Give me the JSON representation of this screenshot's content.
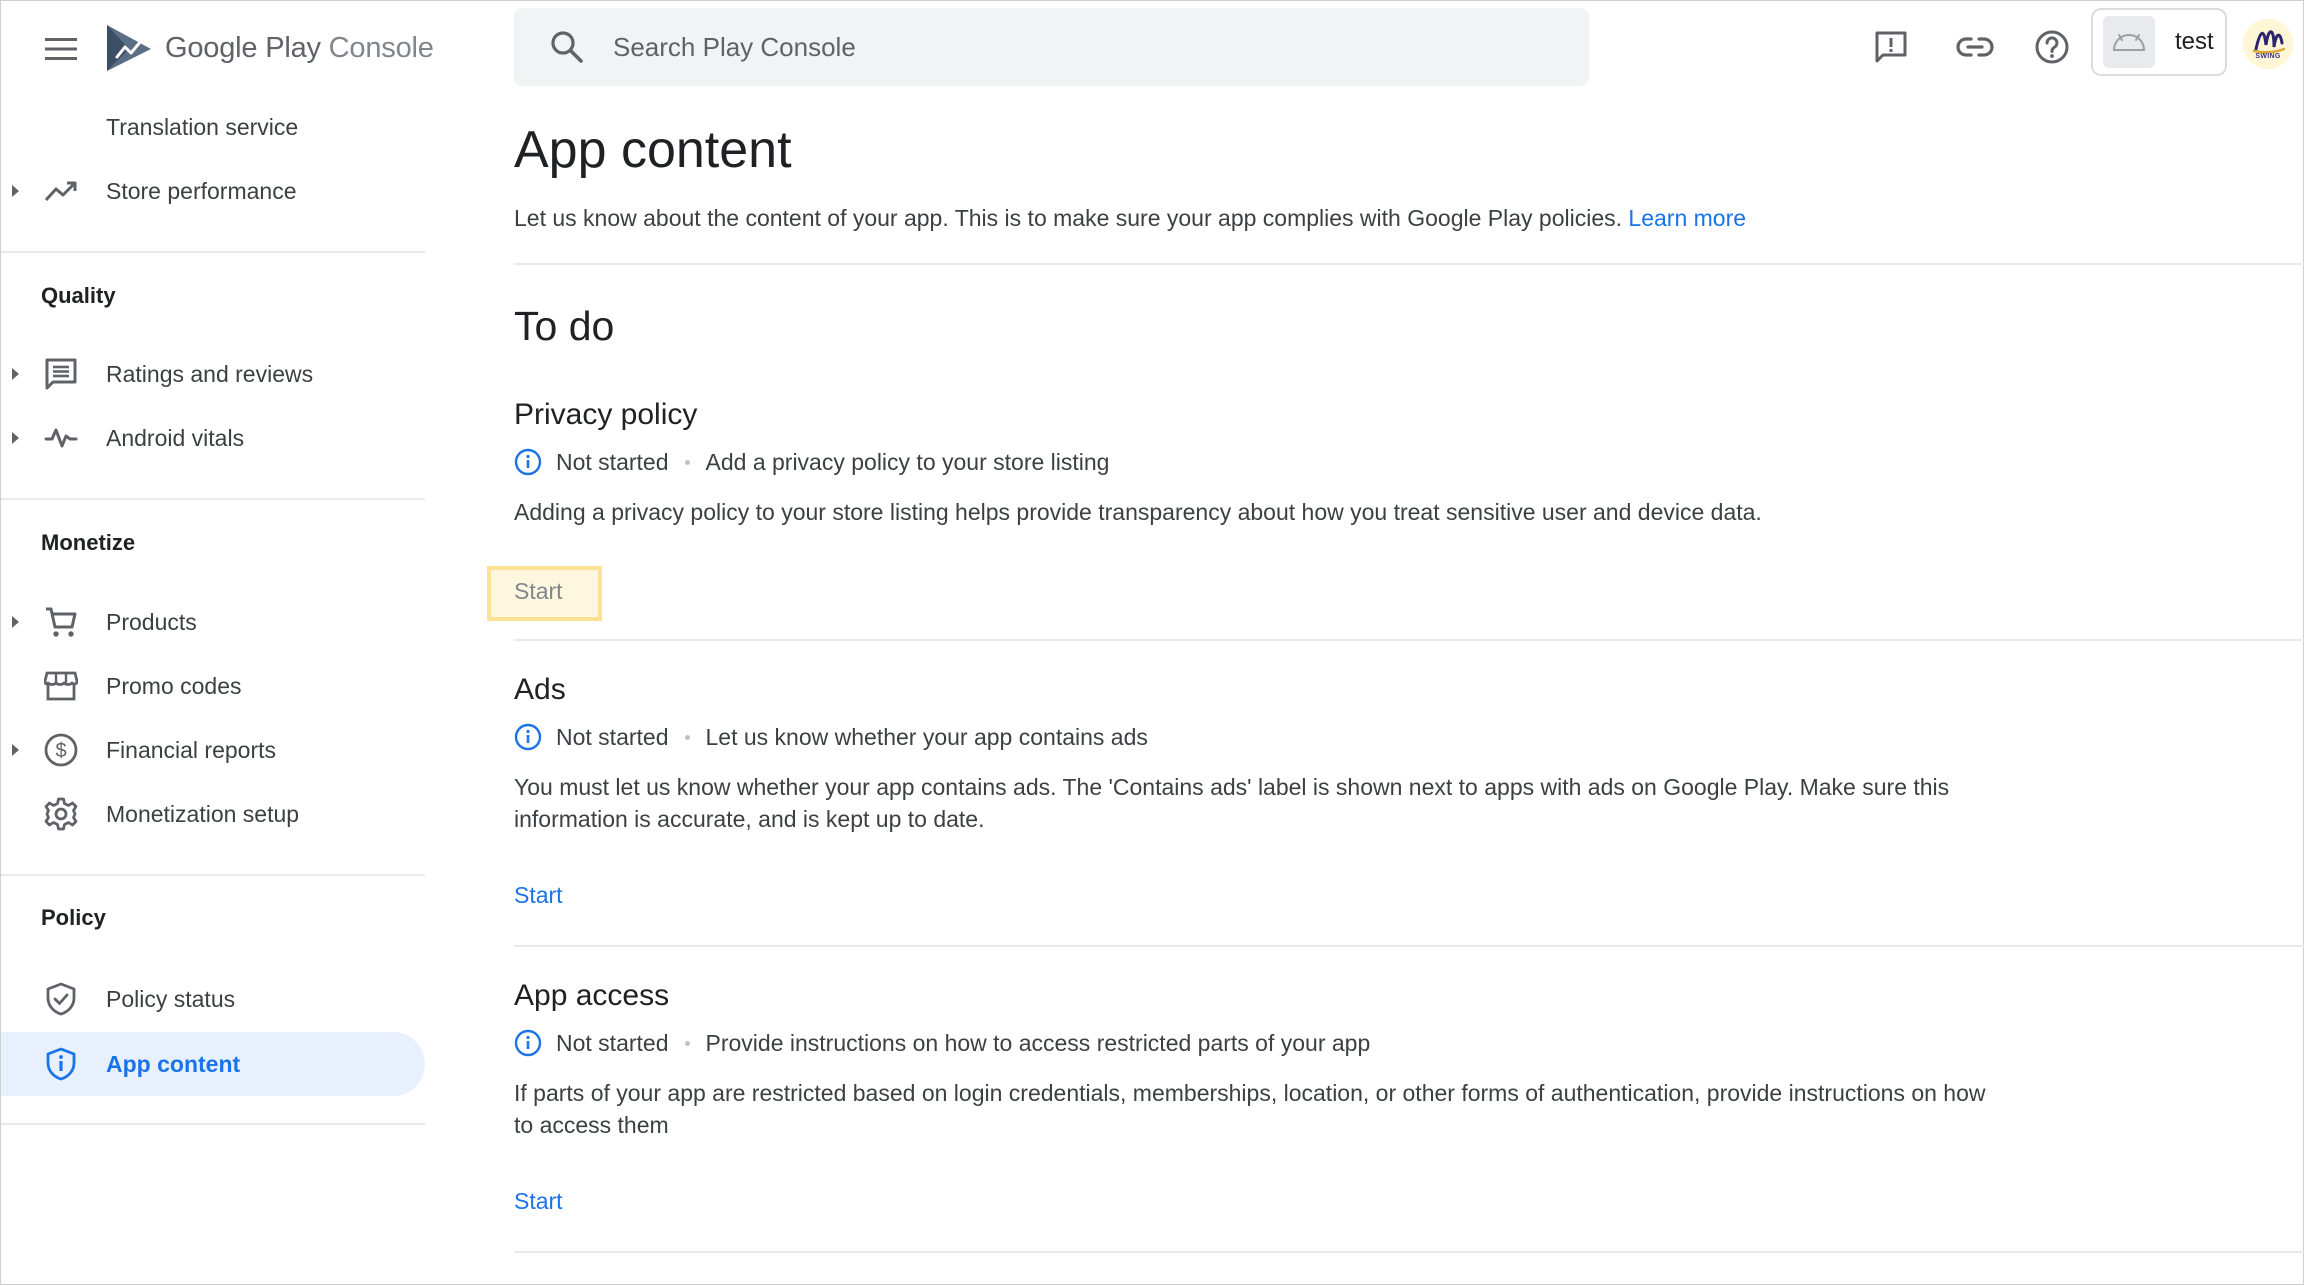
{
  "header": {
    "logo": {
      "word1": "Google",
      "word2": "Play",
      "word3": "Console"
    },
    "search": {
      "placeholder": "Search Play Console"
    },
    "app_name": "test",
    "avatar_label": "SWING"
  },
  "sidebar": {
    "top_items": [
      {
        "label": "Translation service",
        "icon": "none",
        "has_caret": false
      },
      {
        "label": "Store performance",
        "icon": "trending-up-icon",
        "has_caret": true
      }
    ],
    "sections": [
      {
        "title": "Quality",
        "items": [
          {
            "label": "Ratings and reviews",
            "icon": "review-comment-icon",
            "has_caret": true
          },
          {
            "label": "Android vitals",
            "icon": "vitals-pulse-icon",
            "has_caret": true
          }
        ]
      },
      {
        "title": "Monetize",
        "items": [
          {
            "label": "Products",
            "icon": "cart-icon",
            "has_caret": true
          },
          {
            "label": "Promo codes",
            "icon": "store-icon",
            "has_caret": false
          },
          {
            "label": "Financial reports",
            "icon": "dollar-circle-icon",
            "has_caret": true
          },
          {
            "label": "Monetization setup",
            "icon": "gear-icon",
            "has_caret": false
          }
        ]
      },
      {
        "title": "Policy",
        "items": [
          {
            "label": "Policy status",
            "icon": "shield-check-icon",
            "has_caret": false
          },
          {
            "label": "App content",
            "icon": "shield-info-icon",
            "has_caret": false,
            "active": true
          }
        ]
      }
    ]
  },
  "main": {
    "title": "App content",
    "description": "Let us know about the content of your app. This is to make sure your app complies with Google Play policies.",
    "learn_more": "Learn more",
    "todo_title": "To do",
    "tasks": [
      {
        "title": "Privacy policy",
        "status": "Not started",
        "summary": "Add a privacy policy to your store listing",
        "body": "Adding a privacy policy to your store listing helps provide transparency about how you treat sensitive user and device data.",
        "action": "Start",
        "highlighted": true
      },
      {
        "title": "Ads",
        "status": "Not started",
        "summary": "Let us know whether your app contains ads",
        "body": "You must let us know whether your app contains ads. The 'Contains ads' label is shown next to apps with ads on Google Play. Make sure this information is accurate, and is kept up to date.",
        "action": "Start",
        "highlighted": false
      },
      {
        "title": "App access",
        "status": "Not started",
        "summary": "Provide instructions on how to access restricted parts of your app",
        "body": "If parts of your app are restricted based on login credentials, memberships, location, or other forms of authentication, provide instructions on how to access them",
        "action": "Start",
        "highlighted": false
      }
    ]
  },
  "colors": {
    "accent": "#1a73e8",
    "active_nav_bg": "#e8f0fe",
    "highlight_fill": "#fef7e0",
    "highlight_border": "#fde293",
    "icon_gray": "#5f6368"
  }
}
